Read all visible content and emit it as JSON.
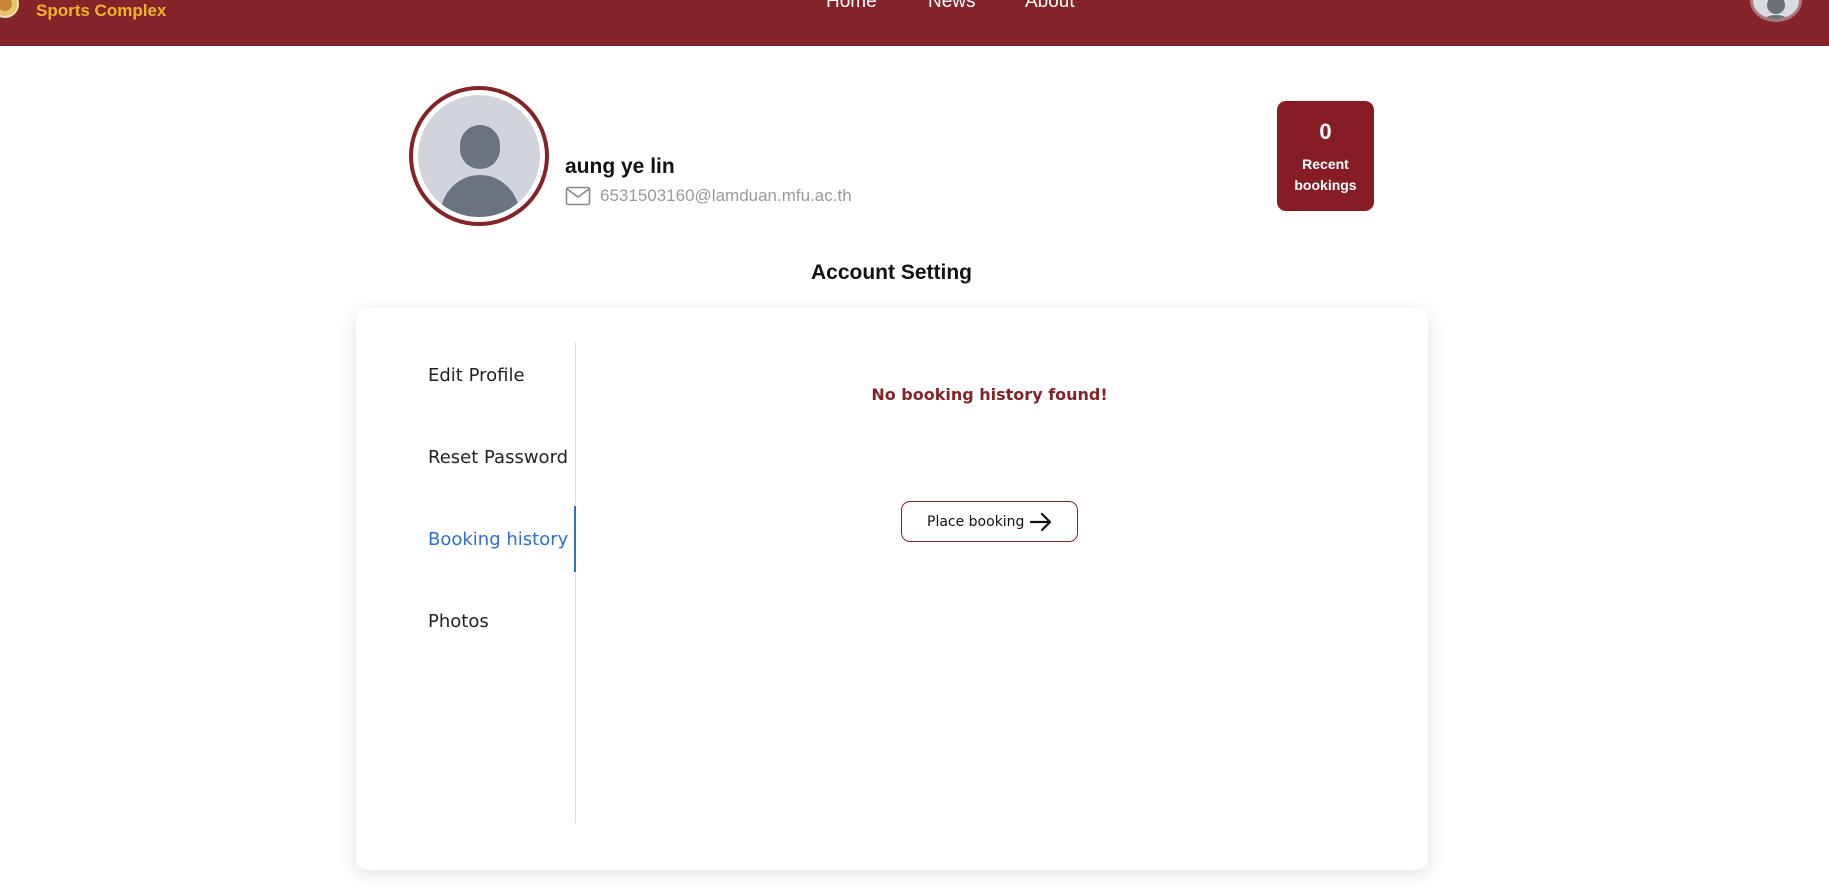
{
  "navbar": {
    "brand": "Sports Complex",
    "links": [
      "Home",
      "News",
      "About"
    ],
    "logo_icon": "crest-logo-icon",
    "avatar_icon": "user-avatar-icon"
  },
  "profile": {
    "name": "aung ye lin",
    "email": "6531503160@lamduan.mfu.ac.th",
    "avatar_icon": "user-avatar-icon",
    "email_icon": "mail-icon",
    "stats": {
      "count": "0",
      "label": "Recent bookings"
    }
  },
  "settings": {
    "title": "Account Setting",
    "sidebar": [
      {
        "label": "Edit Profile",
        "active": false
      },
      {
        "label": "Reset Password",
        "active": false
      },
      {
        "label": "Booking history",
        "active": true
      },
      {
        "label": "Photos",
        "active": false
      }
    ],
    "content": {
      "empty_message": "No booking history found!",
      "button_label": "Place booking",
      "button_icon": "arrow-right-icon"
    }
  },
  "colors": {
    "brand": "#842428",
    "brand_text": "#f0b429",
    "active": "#2f6fd0"
  }
}
